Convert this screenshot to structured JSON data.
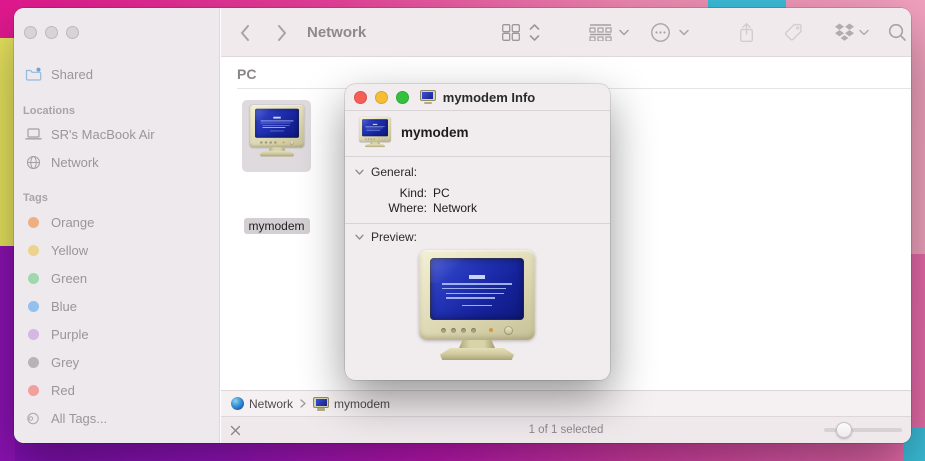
{
  "wallpaper": {
    "magenta": "#e2188f",
    "yellow": "#e9e55f",
    "purple": "#8c12b4",
    "cyan": "#3bbdd9"
  },
  "finder": {
    "window_controls_inactive_color": "#d8d3d6",
    "toolbar": {
      "title": "Network"
    },
    "sidebar": {
      "shared_label": "Shared",
      "locations_header": "Locations",
      "locations": [
        {
          "label": "SR's MacBook Air"
        },
        {
          "label": "Network"
        }
      ],
      "tags_header": "Tags",
      "tags": [
        {
          "label": "Orange",
          "color": "#edb084"
        },
        {
          "label": "Yellow",
          "color": "#ecd38f"
        },
        {
          "label": "Green",
          "color": "#a0d8ae"
        },
        {
          "label": "Blue",
          "color": "#93c0ec"
        },
        {
          "label": "Purple",
          "color": "#d4b7e5"
        },
        {
          "label": "Grey",
          "color": "#b9b3b7"
        },
        {
          "label": "Red",
          "color": "#f2a09d"
        }
      ],
      "all_tags_label": "All Tags..."
    },
    "content": {
      "group_header": "PC",
      "item_name": "mymodem"
    },
    "path_bar": {
      "segments": [
        {
          "label": "Network"
        },
        {
          "label": "mymodem"
        }
      ]
    },
    "status_bar": {
      "selection_text": "1 of 1 selected"
    }
  },
  "info_window": {
    "controls": {
      "close": "#f55f57",
      "minimize": "#f6bd37",
      "zoom": "#35c13c"
    },
    "title": "mymodem Info",
    "item_name": "mymodem",
    "general": {
      "header": "General:",
      "rows": [
        {
          "label": "Kind:",
          "value": "PC"
        },
        {
          "label": "Where:",
          "value": "Network"
        }
      ]
    },
    "preview": {
      "header": "Preview:"
    }
  }
}
